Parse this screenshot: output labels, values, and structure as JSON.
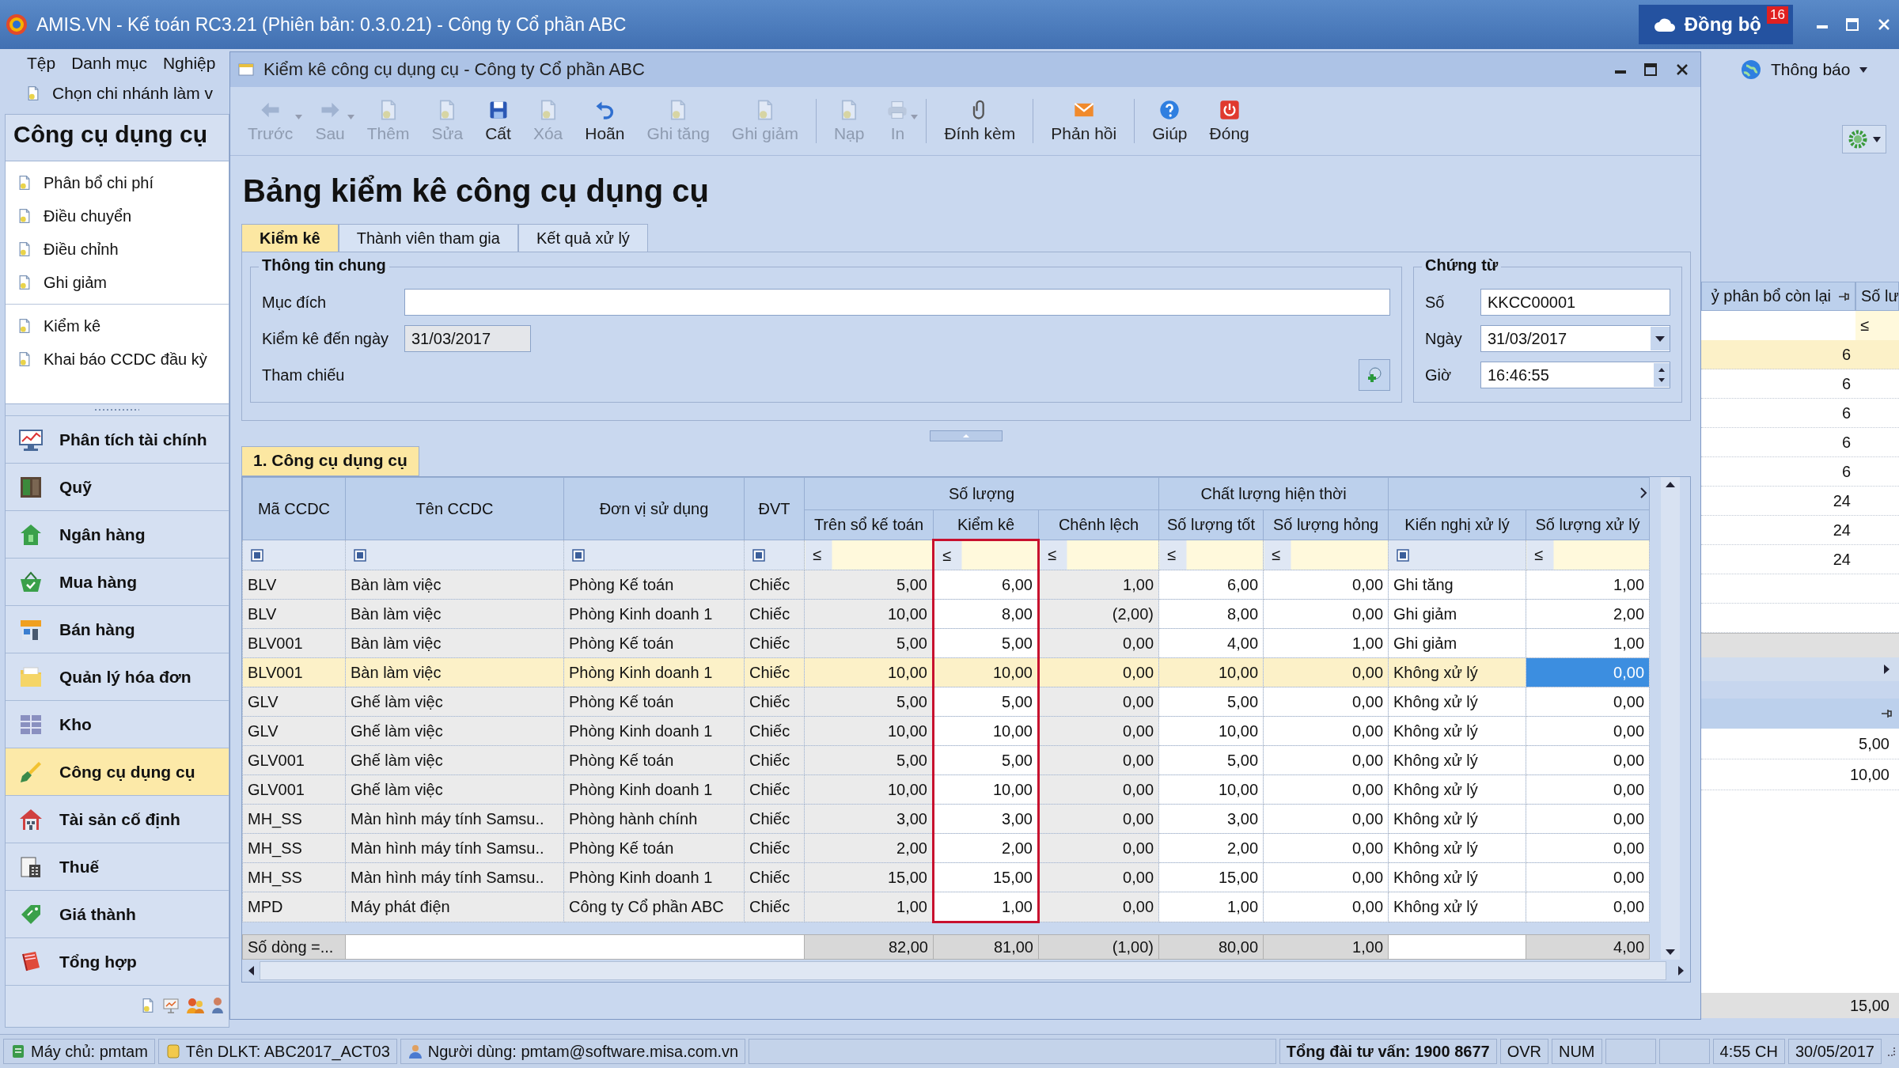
{
  "app": {
    "title": "AMIS.VN - Kế toán RC3.21 (Phiên bản: 0.3.0.21) - Công ty Cổ phần ABC",
    "sync_button": "Đồng bộ",
    "sync_badge": "16"
  },
  "menu": [
    "Tệp",
    "Danh mục",
    "Nghiệp"
  ],
  "branch_bar": "Chọn chi nhánh làm v",
  "sidebar": {
    "title": "Công cụ dụng cụ",
    "task_groups": [
      [
        "Phân bổ chi phí",
        "Điều chuyển",
        "Điều chỉnh",
        "Ghi giảm"
      ],
      [
        "Kiểm kê",
        "Khai báo CCDC đầu kỳ"
      ]
    ],
    "modules": [
      {
        "label": "Phân tích tài chính",
        "kind": "analysis",
        "selected": false
      },
      {
        "label": "Quỹ",
        "kind": "cash",
        "selected": false
      },
      {
        "label": "Ngân hàng",
        "kind": "bank",
        "selected": false
      },
      {
        "label": "Mua hàng",
        "kind": "purchase",
        "selected": false
      },
      {
        "label": "Bán hàng",
        "kind": "sales",
        "selected": false
      },
      {
        "label": "Quản lý hóa đơn",
        "kind": "invoice",
        "selected": false
      },
      {
        "label": "Kho",
        "kind": "warehouse",
        "selected": false
      },
      {
        "label": "Công cụ dụng cụ",
        "kind": "tools",
        "selected": true
      },
      {
        "label": "Tài sản cố định",
        "kind": "assets",
        "selected": false
      },
      {
        "label": "Thuế",
        "kind": "tax",
        "selected": false
      },
      {
        "label": "Giá thành",
        "kind": "cost",
        "selected": false
      },
      {
        "label": "Tổng hợp",
        "kind": "summary",
        "selected": false
      }
    ]
  },
  "window": {
    "title": "Kiểm kê công cụ dụng cụ - Công ty Cổ phần ABC"
  },
  "toolbar": [
    [
      {
        "label": "Trước",
        "kind": "back",
        "disabled": true,
        "dropdown": true
      },
      {
        "label": "Sau",
        "kind": "forward",
        "disabled": true,
        "dropdown": true
      },
      {
        "label": "Thêm",
        "kind": "add",
        "disabled": true,
        "dropdown": false
      },
      {
        "label": "Sửa",
        "kind": "edit",
        "disabled": true,
        "dropdown": false
      },
      {
        "label": "Cất",
        "kind": "save",
        "disabled": false,
        "dropdown": false
      },
      {
        "label": "Xóa",
        "kind": "delete",
        "disabled": true,
        "dropdown": false
      },
      {
        "label": "Hoãn",
        "kind": "undo",
        "disabled": false,
        "dropdown": false
      },
      {
        "label": "Ghi tăng",
        "kind": "increase",
        "disabled": true,
        "dropdown": false
      },
      {
        "label": "Ghi giảm",
        "kind": "decrease",
        "disabled": true,
        "dropdown": false
      }
    ],
    [
      {
        "label": "Nạp",
        "kind": "load",
        "disabled": true,
        "dropdown": false
      },
      {
        "label": "In",
        "kind": "print",
        "disabled": true,
        "dropdown": true
      }
    ],
    [
      {
        "label": "Đính kèm",
        "kind": "attach",
        "disabled": false,
        "dropdown": false
      }
    ],
    [
      {
        "label": "Phản hồi",
        "kind": "feedback",
        "disabled": false,
        "dropdown": false
      }
    ],
    [
      {
        "label": "Giúp",
        "kind": "help",
        "disabled": false,
        "dropdown": false
      },
      {
        "label": "Đóng",
        "kind": "close",
        "disabled": false,
        "dropdown": false
      }
    ]
  ],
  "heading": "Bảng kiểm kê công cụ dụng cụ",
  "tabs": [
    {
      "label": "Kiểm kê",
      "selected": true
    },
    {
      "label": "Thành viên tham gia",
      "selected": false
    },
    {
      "label": "Kết quả xử lý",
      "selected": false
    }
  ],
  "general": {
    "legend": "Thông tin chung",
    "fields": [
      {
        "label": "Mục đích",
        "kind": "text"
      },
      {
        "label": "Kiểm kê đến ngày",
        "kind": "readonly",
        "value": "31/03/2017"
      },
      {
        "label": "Tham chiếu",
        "kind": "reference"
      }
    ]
  },
  "voucher": {
    "legend": "Chứng từ",
    "fields": [
      {
        "label": "Số",
        "kind": "text",
        "value": "KKCC00001"
      },
      {
        "label": "Ngày",
        "kind": "date",
        "value": "31/03/2017"
      },
      {
        "label": "Giờ",
        "kind": "time",
        "value": "16:46:55"
      }
    ]
  },
  "grid": {
    "tab": "1. Công cụ dụng cụ",
    "header": [
      {
        "label": "Mã CCDC",
        "editable": false,
        "filter": {
          "kind": "list"
        }
      },
      {
        "label": "Tên CCDC",
        "editable": false,
        "filter": {
          "kind": "list"
        }
      },
      {
        "label": "Đơn vị sử dụng",
        "editable": false,
        "filter": {
          "kind": "list"
        }
      },
      {
        "label": "ĐVT",
        "editable": false,
        "filter": {
          "kind": "list"
        }
      },
      {
        "label": "Số lượng",
        "columns": [
          {
            "label": "Trên sổ kế toán",
            "editable": false,
            "filter": {
              "kind": "operator",
              "symbol": "≤"
            },
            "total": "82,00"
          },
          {
            "label": "Kiểm kê",
            "editable": true,
            "highlighted": true,
            "filter": {
              "kind": "operator",
              "symbol": "≤"
            },
            "total": "81,00"
          },
          {
            "label": "Chênh lệch",
            "editable": false,
            "filter": {
              "kind": "operator",
              "symbol": "≤"
            },
            "total": "(1,00)"
          }
        ]
      },
      {
        "label": "Chất lượng hiện thời",
        "columns": [
          {
            "label": "Số lượng tốt",
            "editable": true,
            "filter": {
              "kind": "operator",
              "symbol": "≤"
            },
            "total": "80,00"
          },
          {
            "label": "Số lượng hỏng",
            "editable": true,
            "filter": {
              "kind": "operator",
              "symbol": "≤"
            },
            "total": "1,00"
          }
        ]
      },
      {
        "columns": [
          {
            "label": "Kiến nghị xử lý",
            "editable": true,
            "filter": {
              "kind": "list"
            }
          },
          {
            "label": "Số lượng xử lý",
            "editable": true,
            "focused": true,
            "filter": {
              "kind": "operator",
              "symbol": "≤"
            },
            "total": "4,00"
          }
        ]
      }
    ],
    "rows": [
      {
        "cells": [
          "BLV",
          "Bàn làm việc",
          "Phòng Kế toán",
          "Chiếc",
          "5,00",
          "6,00",
          "1,00",
          "6,00",
          "0,00",
          "Ghi tăng",
          "1,00"
        ],
        "selected": false
      },
      {
        "cells": [
          "BLV",
          "Bàn làm việc",
          "Phòng Kinh doanh 1",
          "Chiếc",
          "10,00",
          "8,00",
          "(2,00)",
          "8,00",
          "0,00",
          "Ghi giảm",
          "2,00"
        ],
        "selected": false
      },
      {
        "cells": [
          "BLV001",
          "Bàn làm việc",
          "Phòng Kế toán",
          "Chiếc",
          "5,00",
          "5,00",
          "0,00",
          "4,00",
          "1,00",
          "Ghi giảm",
          "1,00"
        ],
        "selected": false
      },
      {
        "cells": [
          "BLV001",
          "Bàn làm việc",
          "Phòng Kinh doanh 1",
          "Chiếc",
          "10,00",
          "10,00",
          "0,00",
          "10,00",
          "0,00",
          "Không xử lý",
          "0,00"
        ],
        "selected": true
      },
      {
        "cells": [
          "GLV",
          "Ghế làm việc",
          "Phòng Kế toán",
          "Chiếc",
          "5,00",
          "5,00",
          "0,00",
          "5,00",
          "0,00",
          "Không xử lý",
          "0,00"
        ],
        "selected": false
      },
      {
        "cells": [
          "GLV",
          "Ghế làm việc",
          "Phòng Kinh doanh 1",
          "Chiếc",
          "10,00",
          "10,00",
          "0,00",
          "10,00",
          "0,00",
          "Không xử lý",
          "0,00"
        ],
        "selected": false
      },
      {
        "cells": [
          "GLV001",
          "Ghế làm việc",
          "Phòng Kế toán",
          "Chiếc",
          "5,00",
          "5,00",
          "0,00",
          "5,00",
          "0,00",
          "Không xử lý",
          "0,00"
        ],
        "selected": false
      },
      {
        "cells": [
          "GLV001",
          "Ghế làm việc",
          "Phòng Kinh doanh 1",
          "Chiếc",
          "10,00",
          "10,00",
          "0,00",
          "10,00",
          "0,00",
          "Không xử lý",
          "0,00"
        ],
        "selected": false
      },
      {
        "cells": [
          "MH_SS",
          "Màn hình máy tính Samsu..",
          "Phòng hành chính",
          "Chiếc",
          "3,00",
          "3,00",
          "0,00",
          "3,00",
          "0,00",
          "Không xử lý",
          "0,00"
        ],
        "selected": false
      },
      {
        "cells": [
          "MH_SS",
          "Màn hình máy tính Samsu..",
          "Phòng Kế toán",
          "Chiếc",
          "2,00",
          "2,00",
          "0,00",
          "2,00",
          "0,00",
          "Không xử lý",
          "0,00"
        ],
        "selected": false
      },
      {
        "cells": [
          "MH_SS",
          "Màn hình máy tính Samsu..",
          "Phòng Kinh doanh 1",
          "Chiếc",
          "15,00",
          "15,00",
          "0,00",
          "15,00",
          "0,00",
          "Không xử lý",
          "0,00"
        ],
        "selected": false
      },
      {
        "cells": [
          "MPD",
          "Máy phát điện",
          "Công ty Cổ phần ABC",
          "Chiếc",
          "1,00",
          "1,00",
          "0,00",
          "1,00",
          "0,00",
          "Không xử lý",
          "0,00"
        ],
        "selected": false
      }
    ],
    "footer": {
      "label": "Số dòng =..."
    }
  },
  "side_grid": {
    "columns": [
      {
        "label": "ỷ phân bổ còn lại",
        "pinned": true
      },
      {
        "label": "Số lư",
        "filter": "≤"
      }
    ],
    "rows": [
      {
        "value": "6",
        "selected": true
      },
      {
        "value": "6",
        "selected": false
      },
      {
        "value": "6",
        "selected": false
      },
      {
        "value": "6",
        "selected": false
      },
      {
        "value": "6",
        "selected": false
      },
      {
        "value": "24",
        "selected": false
      },
      {
        "value": "24",
        "selected": false
      },
      {
        "value": "24",
        "selected": false
      }
    ]
  },
  "lower_grid": {
    "rows": [
      "5,00",
      "10,00"
    ],
    "total": "15,00"
  },
  "notifications": "Thông báo",
  "status_bar": [
    {
      "kind": "server",
      "text": "Máy chủ: pmtam"
    },
    {
      "kind": "database",
      "text": "Tên DLKT: ABC2017_ACT03"
    },
    {
      "kind": "user",
      "text": "Người dùng: pmtam@software.misa.com.vn"
    },
    {
      "kind": "spacer"
    },
    {
      "kind": "hotline",
      "text": "Tổng đài tư vấn: 1900 8677"
    },
    {
      "kind": "plain",
      "text": "OVR"
    },
    {
      "kind": "plain",
      "text": "NUM"
    },
    {
      "kind": "blank"
    },
    {
      "kind": "blank"
    },
    {
      "kind": "plain",
      "text": "4:55 CH"
    },
    {
      "kind": "plain",
      "text": "30/05/2017"
    }
  ]
}
